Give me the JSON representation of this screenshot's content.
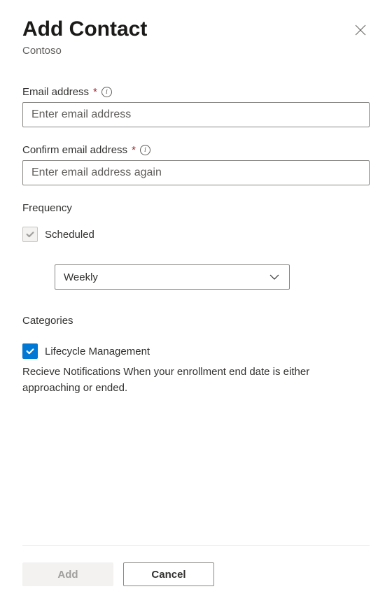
{
  "header": {
    "title": "Add Contact",
    "subtitle": "Contoso"
  },
  "fields": {
    "email": {
      "label": "Email address",
      "required_marker": "*",
      "placeholder": "Enter email address",
      "value": ""
    },
    "confirm_email": {
      "label": "Confirm email address",
      "required_marker": "*",
      "placeholder": "Enter email address again",
      "value": ""
    }
  },
  "frequency": {
    "label": "Frequency",
    "scheduled": {
      "label": "Scheduled",
      "checked": true,
      "disabled": true
    },
    "select": {
      "value": "Weekly"
    }
  },
  "categories": {
    "label": "Categories",
    "lifecycle": {
      "label": "Lifecycle Management",
      "checked": true,
      "description": "Recieve Notifications When your enrollment end date is either approaching or ended."
    }
  },
  "footer": {
    "add_label": "Add",
    "cancel_label": "Cancel"
  }
}
